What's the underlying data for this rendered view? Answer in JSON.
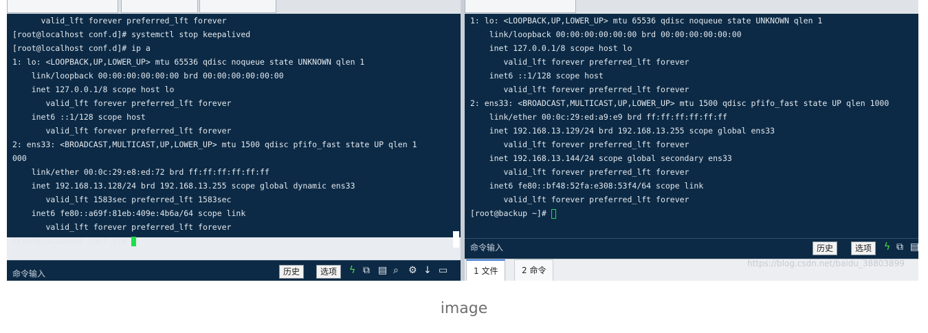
{
  "left_terminal": {
    "lines": [
      "      valid_lft forever preferred_lft forever",
      "[root@localhost conf.d]# systemctl stop keepalived",
      "[root@localhost conf.d]# ip a",
      "1: lo: <LOOPBACK,UP,LOWER_UP> mtu 65536 qdisc noqueue state UNKNOWN qlen 1",
      "    link/loopback 00:00:00:00:00:00 brd 00:00:00:00:00:00",
      "    inet 127.0.0.1/8 scope host lo",
      "       valid_lft forever preferred_lft forever",
      "    inet6 ::1/128 scope host",
      "       valid_lft forever preferred_lft forever",
      "2: ens33: <BROADCAST,MULTICAST,UP,LOWER_UP> mtu 1500 qdisc pfifo_fast state UP qlen 1",
      "000",
      "    link/ether 00:0c:29:e8:ed:72 brd ff:ff:ff:ff:ff:ff",
      "    inet 192.168.13.128/24 brd 192.168.13.255 scope global dynamic ens33",
      "       valid_lft 1583sec preferred_lft 1583sec",
      "    inet6 fe80::a69f:81eb:409e:4b6a/64 scope link",
      "       valid_lft forever preferred_lft forever"
    ],
    "prompt": "[root@localhost conf.d]# ",
    "cmd_label": "命令输入",
    "history_button": "历史",
    "options_button": "选项"
  },
  "right_terminal": {
    "lines": [
      "1: lo: <LOOPBACK,UP,LOWER_UP> mtu 65536 qdisc noqueue state UNKNOWN qlen 1",
      "    link/loopback 00:00:00:00:00:00 brd 00:00:00:00:00:00",
      "    inet 127.0.0.1/8 scope host lo",
      "       valid_lft forever preferred_lft forever",
      "    inet6 ::1/128 scope host",
      "       valid_lft forever preferred_lft forever",
      "2: ens33: <BROADCAST,MULTICAST,UP,LOWER_UP> mtu 1500 qdisc pfifo_fast state UP qlen 1000",
      "    link/ether 00:0c:29:ed:a9:e9 brd ff:ff:ff:ff:ff:ff",
      "    inet 192.168.13.129/24 brd 192.168.13.255 scope global ens33",
      "       valid_lft forever preferred_lft forever",
      "    inet 192.168.13.144/24 scope global secondary ens33",
      "       valid_lft forever preferred_lft forever",
      "    inet6 fe80::bf48:52fa:e308:53f4/64 scope link",
      "       valid_lft forever preferred_lft forever"
    ],
    "prompt": "[root@backup ~]# ",
    "cmd_label": "命令输入",
    "history_button": "历史",
    "options_button": "选项",
    "bottom_tabs": [
      "1 文件",
      "2 命令"
    ],
    "watermark": "https://blog.csdn.net/baidu_38803899"
  },
  "caption": "image",
  "colors": {
    "terminal_bg": "#0c2a45",
    "terminal_text": "#e3e8ee",
    "cursor": "#19e04a",
    "accent_tab": "#3a7bd5"
  },
  "icons": [
    "lightning-icon",
    "copy-icon",
    "paste-icon",
    "search-icon",
    "gear-icon",
    "download-icon",
    "window-icon"
  ]
}
